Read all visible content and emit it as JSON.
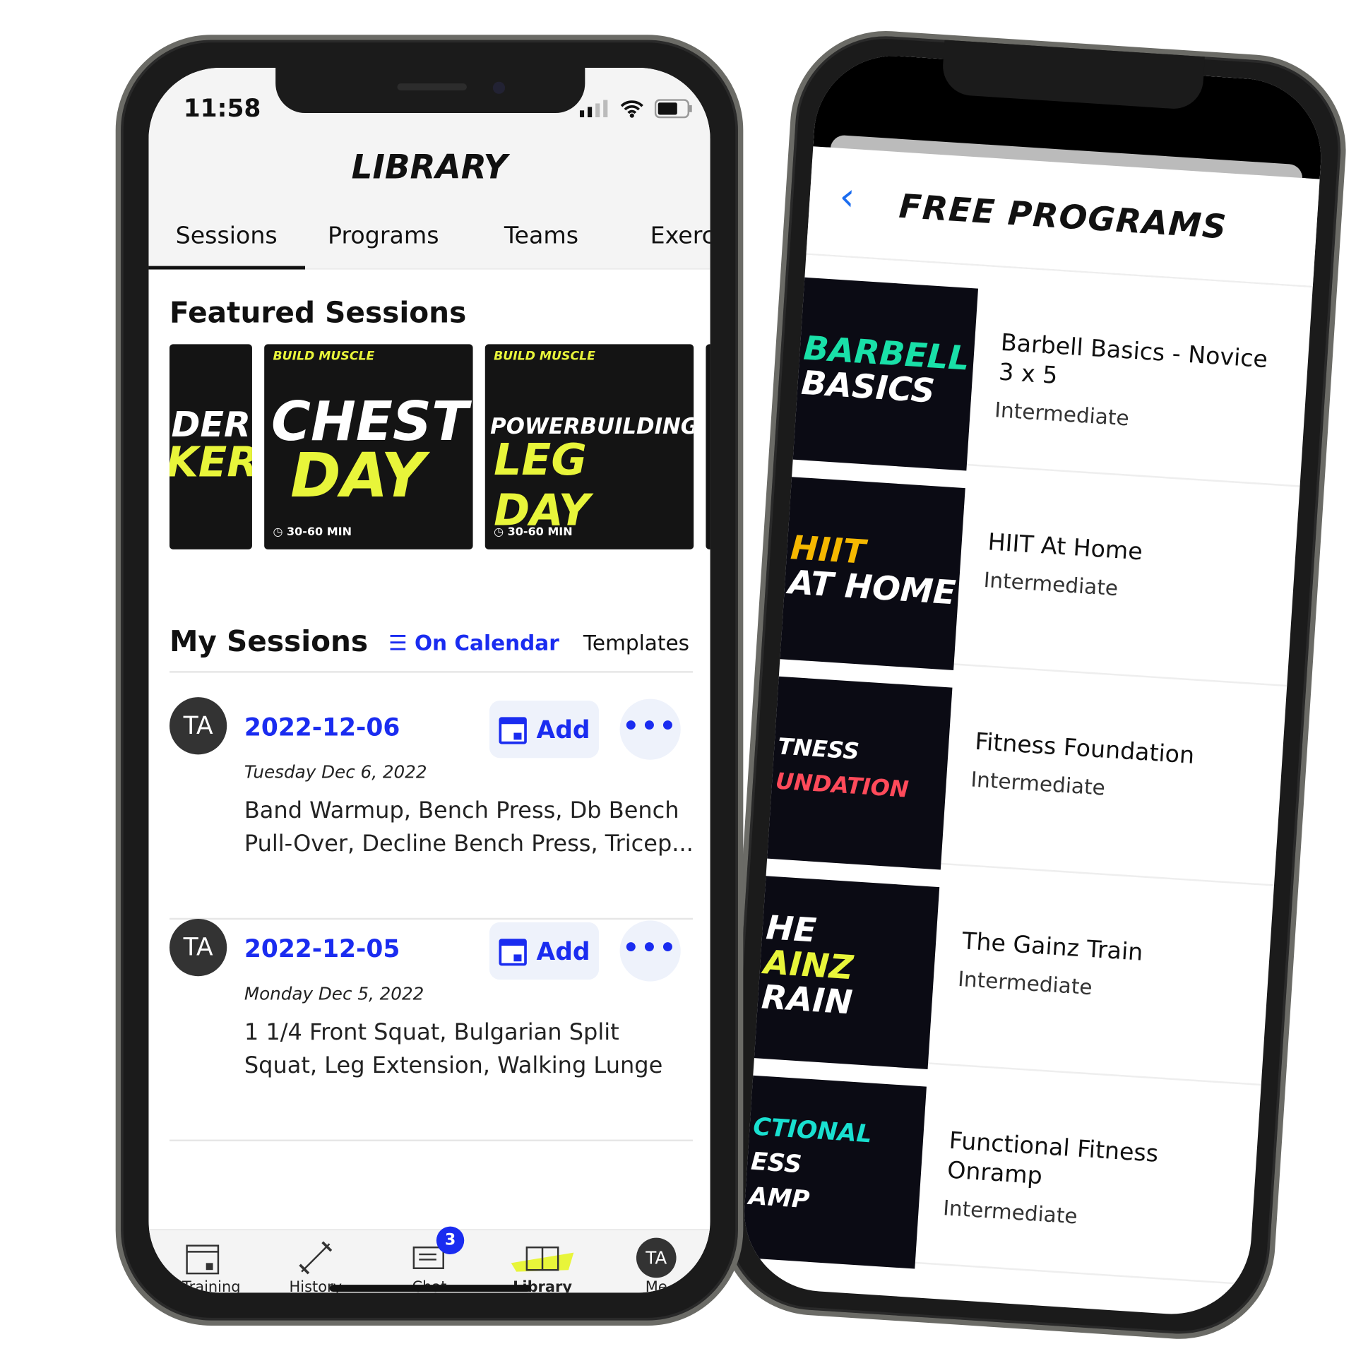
{
  "left_phone": {
    "status": {
      "time": "11:58"
    },
    "header": {
      "title": "LIBRARY"
    },
    "tabs": [
      {
        "label": "Sessions",
        "active": true
      },
      {
        "label": "Programs"
      },
      {
        "label": "Teams"
      },
      {
        "label": "Exerc"
      }
    ],
    "featured": {
      "title": "Featured Sessions",
      "cards": [
        {
          "line1": "DER",
          "line2": "KER"
        },
        {
          "tag": "BUILD MUSCLE",
          "line1": "CHEST",
          "line2": "DAY",
          "duration": "30-60 MIN"
        },
        {
          "tag": "BUILD MUSCLE",
          "line1": "POWERBUILDING",
          "line2": "LEG DAY",
          "duration": "30-60 MIN"
        }
      ]
    },
    "my_sessions": {
      "title": "My Sessions",
      "filter_label": "On Calendar",
      "templates_label": "Templates",
      "items": [
        {
          "avatar": "TA",
          "date": "2022-12-06",
          "add_label": "Add",
          "more": "•••",
          "day": "Tuesday Dec 6, 2022",
          "exercises": "Band Warmup, Bench Press, Db Bench Pull-Over, Decline Bench Press, Tricep..."
        },
        {
          "avatar": "TA",
          "date": "2022-12-05",
          "add_label": "Add",
          "more": "•••",
          "day": "Monday Dec 5, 2022",
          "exercises": "1 1/4 Front Squat, Bulgarian Split Squat, Leg Extension, Walking Lunge"
        }
      ]
    },
    "nav": [
      {
        "label": "Training"
      },
      {
        "label": "History"
      },
      {
        "label": "Chat",
        "badge": "3"
      },
      {
        "label": "Library",
        "active": true
      },
      {
        "label": "Me",
        "avatar": "TA"
      }
    ],
    "colors": {
      "accent": "#1a2cf0",
      "highlight": "#e8f53a"
    }
  },
  "right_phone": {
    "header": {
      "title": "FREE PROGRAMS",
      "back": "‹"
    },
    "programs": [
      {
        "thumb": [
          "BARBELL",
          "BASICS"
        ],
        "thumb_color": "#19e0a8",
        "name": "Barbell Basics - Novice 3 x 5",
        "level": "Intermediate"
      },
      {
        "thumb": [
          "HIIT",
          "AT HOME"
        ],
        "thumb_color": "#f5b800",
        "name": "HIIT At Home",
        "level": "Intermediate"
      },
      {
        "thumb": [
          "TNESS",
          "UNDATION"
        ],
        "thumb_color": "#ff4a5a",
        "name": "Fitness Foundation",
        "level": "Intermediate"
      },
      {
        "thumb": [
          "HE",
          "AINZ",
          "RAIN"
        ],
        "thumb_color": "#e8f53a",
        "name": "The Gainz Train",
        "level": "Intermediate"
      },
      {
        "thumb": [
          "CTIONAL",
          "ESS",
          "AMP"
        ],
        "thumb_color": "#19e0d0",
        "name": "Functional Fitness Onramp",
        "level": "Intermediate"
      }
    ]
  }
}
